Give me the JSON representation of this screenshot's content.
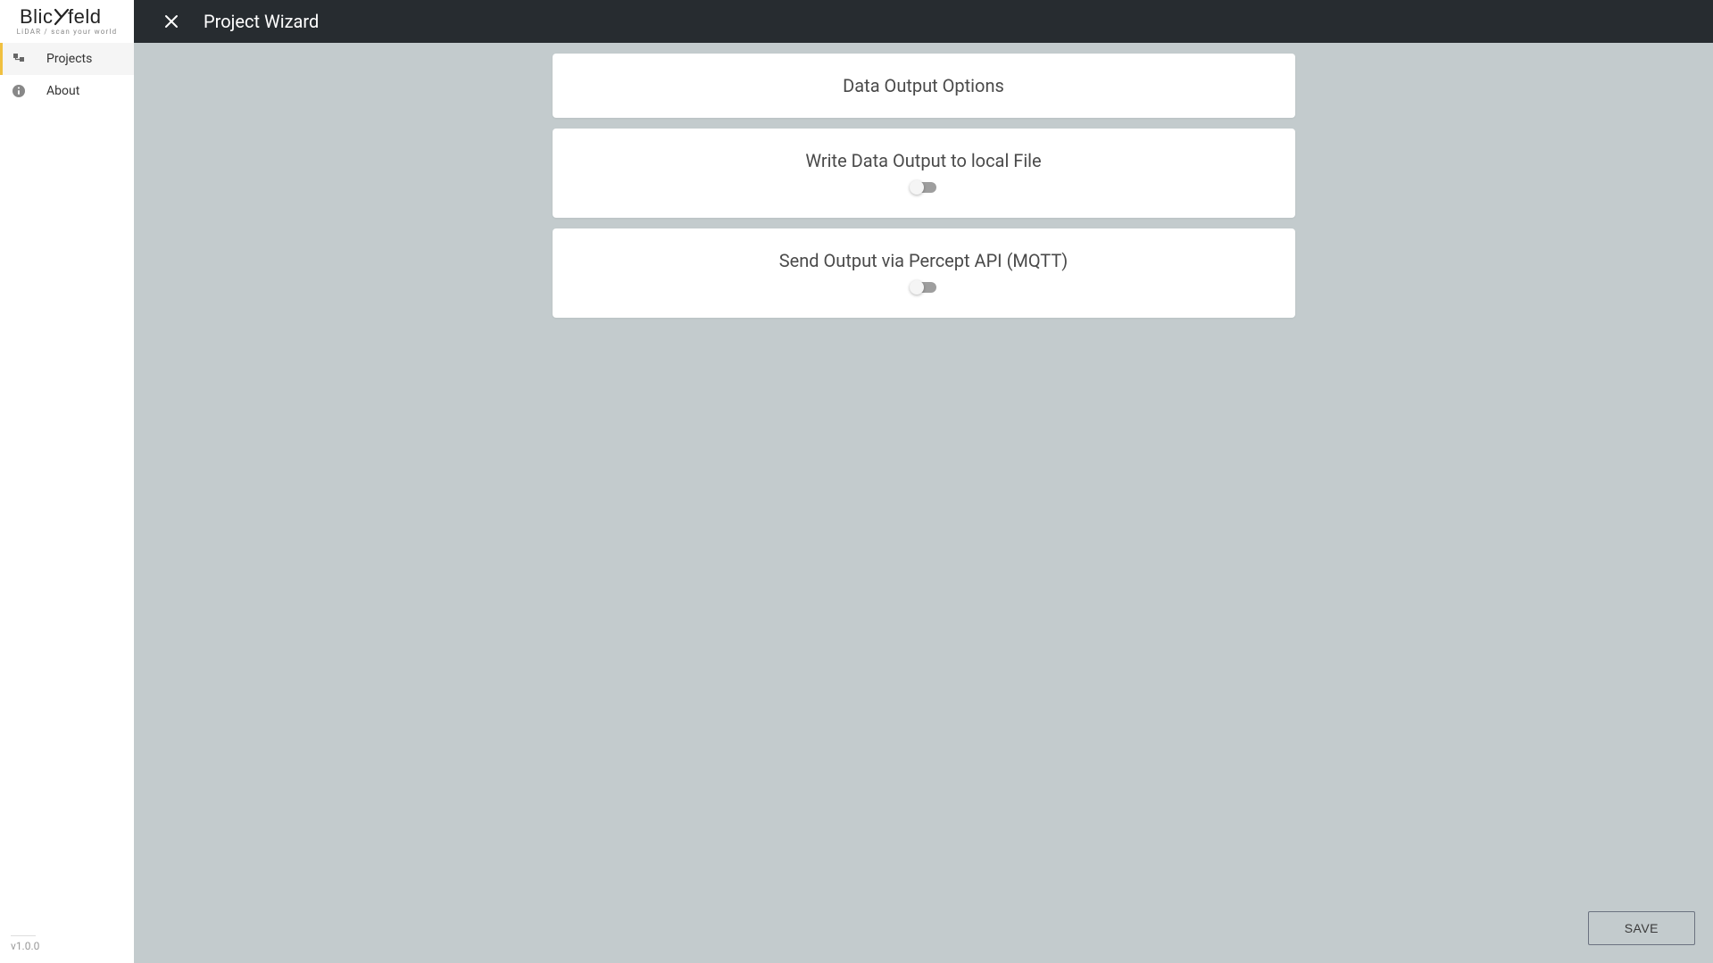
{
  "header": {
    "title": "Project Wizard",
    "logo_main": "Blickfeld",
    "logo_tagline": "LiDAR / scan your world"
  },
  "sidebar": {
    "items": [
      {
        "label": "Projects",
        "active": true
      },
      {
        "label": "About",
        "active": false
      }
    ],
    "version": "v1.0.0"
  },
  "main": {
    "cards": [
      {
        "title": "Data Output Options"
      },
      {
        "title": "Write Data Output to local File",
        "toggle": false
      },
      {
        "title": "Send Output via Percept API (MQTT)",
        "toggle": false
      }
    ],
    "save_label": "SAVE"
  }
}
